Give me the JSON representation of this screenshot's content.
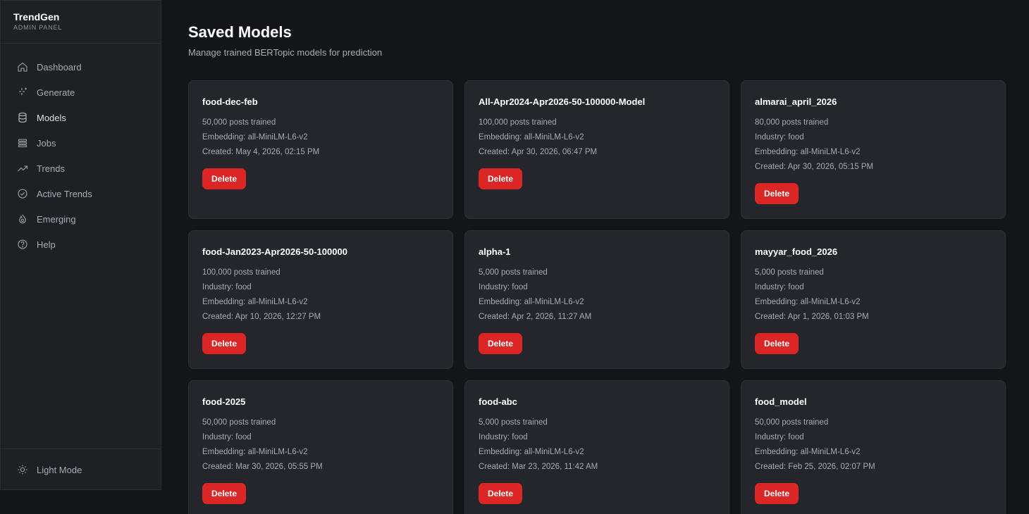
{
  "sidebar": {
    "brand_name": "TrendGen",
    "brand_sub": "ADMIN PANEL",
    "items": [
      {
        "label": "Dashboard",
        "icon": "home-icon"
      },
      {
        "label": "Generate",
        "icon": "sparkles-icon"
      },
      {
        "label": "Models",
        "icon": "database-icon",
        "active": true
      },
      {
        "label": "Jobs",
        "icon": "list-icon"
      },
      {
        "label": "Trends",
        "icon": "trending-up-icon"
      },
      {
        "label": "Active Trends",
        "icon": "check-circle-icon"
      },
      {
        "label": "Emerging",
        "icon": "flame-icon"
      },
      {
        "label": "Help",
        "icon": "help-circle-icon"
      }
    ],
    "theme_toggle": "Light Mode"
  },
  "page": {
    "title": "Saved Models",
    "subtitle": "Manage trained BERTopic models for prediction"
  },
  "delete_label": "Delete",
  "colors": {
    "accent_delete": "#dc2626",
    "card_bg": "#24262b",
    "sidebar_bg": "#1e2024"
  },
  "models": [
    {
      "name": "food-dec-feb",
      "lines": [
        "50,000 posts trained",
        "Embedding: all-MiniLM-L6-v2",
        "Created: May 4, 2026, 02:15 PM"
      ]
    },
    {
      "name": "All-Apr2024-Apr2026-50-100000-Model",
      "lines": [
        "100,000 posts trained",
        "Embedding: all-MiniLM-L6-v2",
        "Created: Apr 30, 2026, 06:47 PM"
      ]
    },
    {
      "name": "almarai_april_2026",
      "lines": [
        "80,000 posts trained",
        "Industry: food",
        "Embedding: all-MiniLM-L6-v2",
        "Created: Apr 30, 2026, 05:15 PM"
      ]
    },
    {
      "name": "food-Jan2023-Apr2026-50-100000",
      "lines": [
        "100,000 posts trained",
        "Industry: food",
        "Embedding: all-MiniLM-L6-v2",
        "Created: Apr 10, 2026, 12:27 PM"
      ]
    },
    {
      "name": "alpha-1",
      "lines": [
        "5,000 posts trained",
        "Industry: food",
        "Embedding: all-MiniLM-L6-v2",
        "Created: Apr 2, 2026, 11:27 AM"
      ]
    },
    {
      "name": "mayyar_food_2026",
      "lines": [
        "5,000 posts trained",
        "Industry: food",
        "Embedding: all-MiniLM-L6-v2",
        "Created: Apr 1, 2026, 01:03 PM"
      ]
    },
    {
      "name": "food-2025",
      "lines": [
        "50,000 posts trained",
        "Industry: food",
        "Embedding: all-MiniLM-L6-v2",
        "Created: Mar 30, 2026, 05:55 PM"
      ]
    },
    {
      "name": "food-abc",
      "lines": [
        "5,000 posts trained",
        "Industry: food",
        "Embedding: all-MiniLM-L6-v2",
        "Created: Mar 23, 2026, 11:42 AM"
      ]
    },
    {
      "name": "food_model",
      "lines": [
        "50,000 posts trained",
        "Industry: food",
        "Embedding: all-MiniLM-L6-v2",
        "Created: Feb 25, 2026, 02:07 PM"
      ]
    }
  ]
}
